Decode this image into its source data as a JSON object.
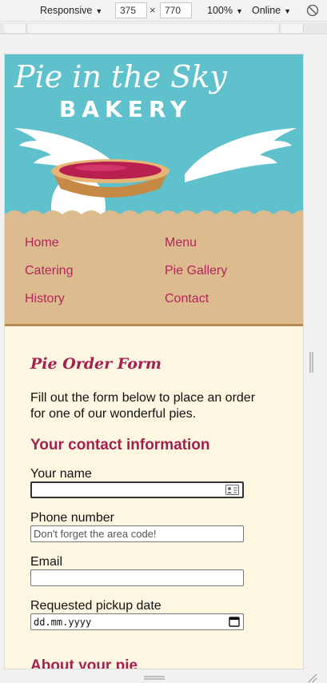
{
  "toolbar": {
    "device": "Responsive",
    "width": "375",
    "height": "770",
    "times": "×",
    "zoom": "100%",
    "network": "Online"
  },
  "site": {
    "logo_script": "Pie in the Sky",
    "logo_block": "BAKERY"
  },
  "nav": {
    "items": [
      {
        "label": "Home"
      },
      {
        "label": "Menu"
      },
      {
        "label": "Catering"
      },
      {
        "label": "Pie Gallery"
      },
      {
        "label": "History"
      },
      {
        "label": "Contact"
      }
    ]
  },
  "form": {
    "title": "Pie Order Form",
    "intro": "Fill out the form below to place an order for one of our wonderful pies.",
    "contact_section": "Your contact information",
    "name_label": "Your name",
    "name_value": "",
    "phone_label": "Phone number",
    "phone_placeholder": "Don't forget the area code!",
    "email_label": "Email",
    "email_value": "",
    "date_label": "Requested pickup date",
    "date_value": "dd.mm.yyyy",
    "pie_section": "About your pie"
  },
  "colors": {
    "sky": "#5ec1cc",
    "crust": "#dcbb8f",
    "accent": "#a3214f",
    "cream": "#fdf6e1"
  }
}
